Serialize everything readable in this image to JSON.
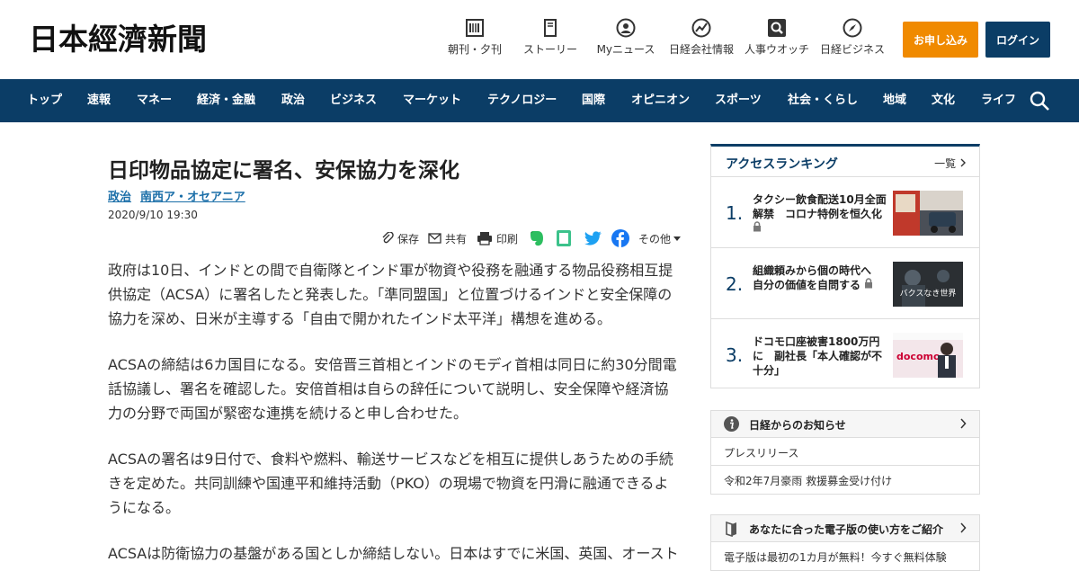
{
  "header": {
    "logo": "日本經濟新聞",
    "nav": [
      {
        "label": "朝刊・夕刊",
        "icon": "newspaper-icon"
      },
      {
        "label": "ストーリー",
        "icon": "book-icon"
      },
      {
        "label": "Myニュース",
        "icon": "user-icon"
      },
      {
        "label": "日経会社情報",
        "icon": "chart-icon"
      },
      {
        "label": "人事ウオッチ",
        "icon": "magnifier-icon"
      },
      {
        "label": "日経ビジネス",
        "icon": "compass-icon"
      }
    ],
    "apply_label": "お申し込み",
    "login_label": "ログイン"
  },
  "navbar": {
    "items": [
      "トップ",
      "速報",
      "マネー",
      "経済・金融",
      "政治",
      "ビジネス",
      "マーケット",
      "テクノロジー",
      "国際",
      "オピニオン",
      "スポーツ",
      "社会・くらし",
      "地域",
      "文化",
      "ライフ"
    ]
  },
  "article": {
    "title": "日印物品協定に署名、安保協力を深化",
    "tags": [
      "政治",
      "南西ア・オセアニア"
    ],
    "date": "2020/9/10 19:30",
    "tools": {
      "save": "保存",
      "share": "共有",
      "print": "印刷",
      "other": "その他"
    },
    "paragraphs": [
      [
        "政府は10日、インドとの間で自衛隊とインド軍が物資や役務を融通する物品役務相互提",
        "供協定（ACSA）に署名したと発表した。「準同盟国」と位置づけるインドと安全保障の",
        "協力を深め、日米が主導する「自由で開かれたインド太平洋」構想を進める。"
      ],
      [
        "ACSAの締結は6カ国目になる。安倍晋三首相とインドのモディ首相は同日に約30分間電",
        "話協議し、署名を確認した。安倍首相は自らの辞任について説明し、安全保障や経済協",
        "力の分野で両国が緊密な連携を続けると申し合わせた。"
      ],
      [
        "ACSAの署名は9日付で、食料や燃料、輸送サービスなどを相互に提供しあうための手続",
        "きを定めた。共同訓練や国連平和維持活動（PKO）の現場で物資を円滑に融通できるよ",
        "うになる。"
      ],
      [
        "ACSAは防衛協力の基盤がある国としか締結しない。日本はすでに米国、英国、オースト"
      ]
    ]
  },
  "ranking": {
    "title": "アクセスランキング",
    "more": "一覧",
    "items": [
      {
        "num": "1.",
        "lines": [
          "タクシー飲食配送10月全面",
          "解禁　コロナ特例を恒久化"
        ],
        "image": "taxi-photo"
      },
      {
        "num": "2.",
        "lines": [
          "組織頼みから個の時代へ",
          "自分の価値を自問する"
        ],
        "image": "baxu-world-photo",
        "img_text": "バクスなき世界"
      },
      {
        "num": "3.",
        "lines": [
          "ドコモ口座被害1800万円",
          "に　副社長「本人確認が不",
          "十分」"
        ],
        "image": "docomo-press-photo",
        "img_text": "docomo"
      }
    ]
  },
  "notices": {
    "title": "日経からのお知らせ",
    "items": [
      "プレスリリース",
      "令和2年7月豪雨 救援募金受け付け"
    ]
  },
  "guide": {
    "title": "あなたに合った電子版の使い方をご紹介",
    "items": [
      "電子版は最初の1カ月が無料！今すぐ無料体験"
    ]
  }
}
